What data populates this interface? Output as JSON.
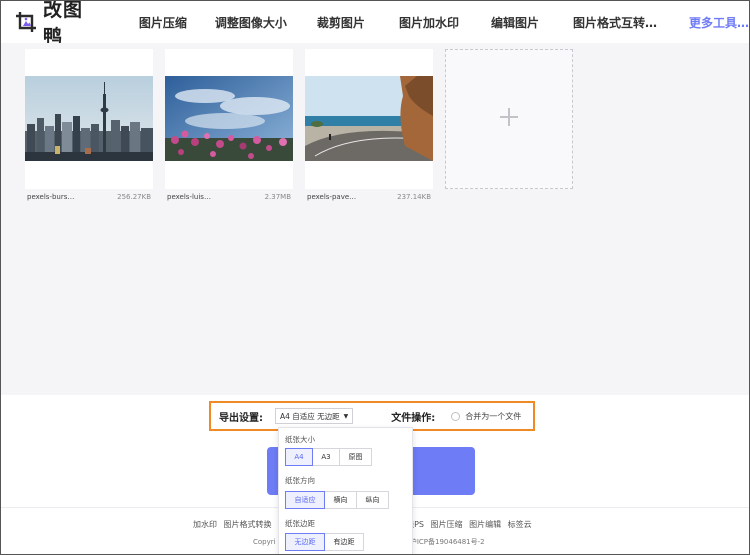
{
  "app": {
    "logo_text": "改图鸭"
  },
  "nav": {
    "items": [
      "图片压缩",
      "调整图像大小",
      "裁剪图片",
      "图片加水印",
      "编辑图片",
      "图片格式互转…"
    ],
    "more": "更多工具…"
  },
  "files": [
    {
      "name": "pexels-burs…",
      "size": "256.27KB",
      "thumb": "city-skyline"
    },
    {
      "name": "pexels-luis…",
      "size": "2.37MB",
      "thumb": "flowers-sky"
    },
    {
      "name": "pexels-pave…",
      "size": "237.14KB",
      "thumb": "coastal-road"
    }
  ],
  "add_button_icon": "plus-icon",
  "export": {
    "label": "导出设置:",
    "selected": "A4 自适应 无边距",
    "file_op_label": "文件操作:",
    "merge_label": "合并为一个文件"
  },
  "dropdown": {
    "paper_size_title": "纸张大小",
    "paper_sizes": [
      "A4",
      "A3",
      "原图"
    ],
    "orientation_title": "纸张方向",
    "orientations": [
      "自适应",
      "横向",
      "纵向"
    ],
    "margin_title": "纸张边距",
    "margins": [
      "无边距",
      "有边距"
    ]
  },
  "footer": {
    "links_left": [
      "加水印",
      "图片格式转换"
    ],
    "links_right": [
      "在线PS",
      "图片压缩",
      "图片编辑",
      "标签云"
    ],
    "copy_left": "Copyri",
    "copy_right": "沪ICP备19046481号-2"
  },
  "colors": {
    "accent": "#6e7cf6",
    "highlight_border": "#f08a24"
  }
}
